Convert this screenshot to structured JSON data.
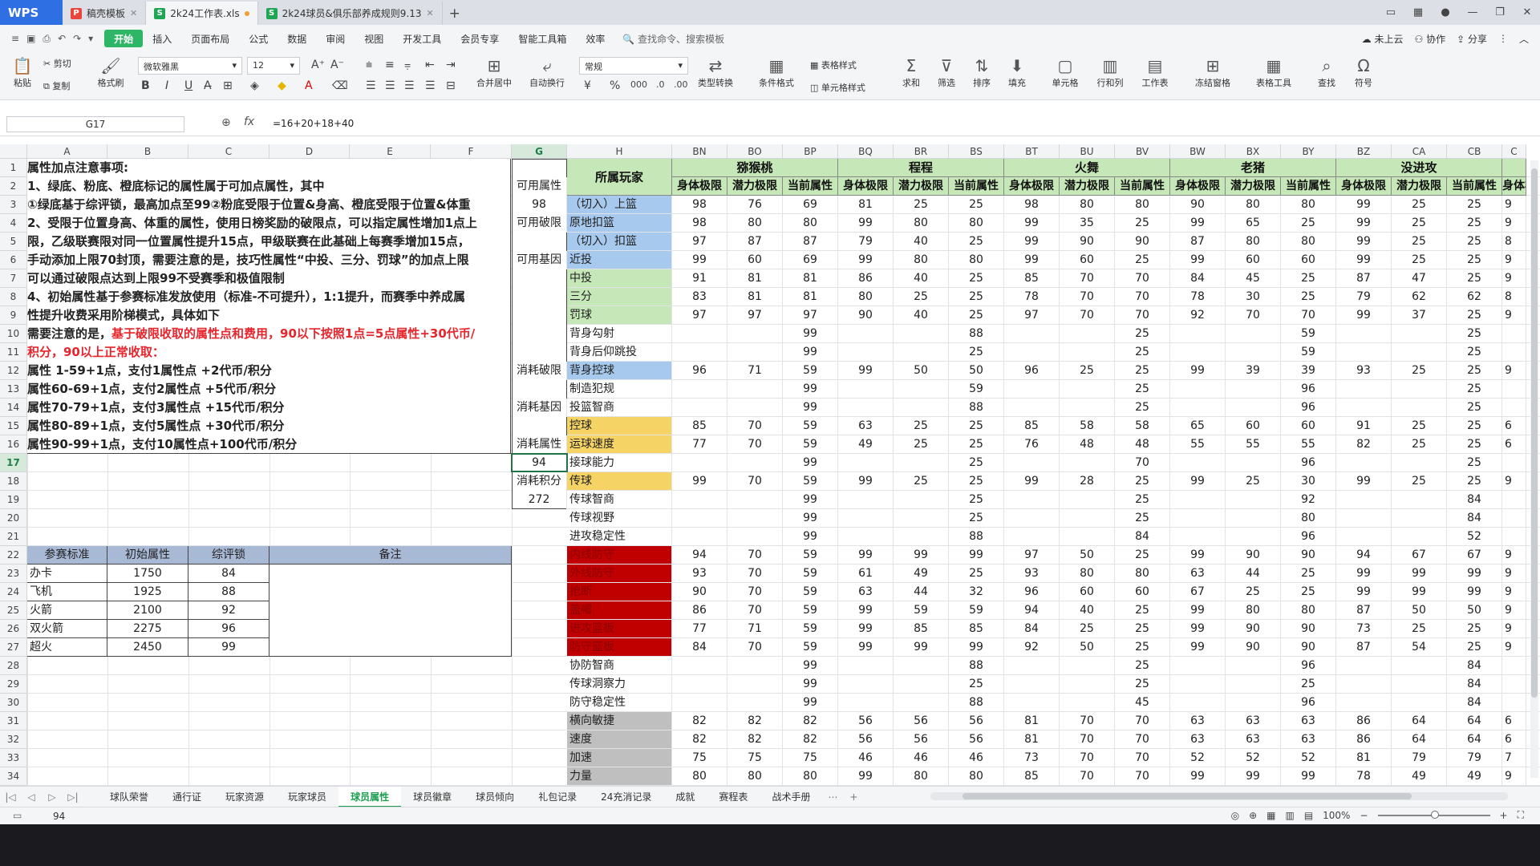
{
  "file_tabs": [
    {
      "label": "稿壳模板",
      "color": "#e8463c",
      "icon": "P",
      "active": false
    },
    {
      "label": "2k24工作表.xls",
      "color": "#1fa654",
      "icon": "S",
      "active": true
    },
    {
      "label": "2k24球员&俱乐部养成规则9.13",
      "color": "#1fa654",
      "icon": "S",
      "active": false
    }
  ],
  "menu": [
    "开始",
    "插入",
    "页面布局",
    "公式",
    "数据",
    "审阅",
    "视图",
    "开发工具",
    "会员专享",
    "智能工具箱",
    "效率"
  ],
  "menu_active": "开始",
  "search_placeholder": "查找命令、搜索模板",
  "menu_right": {
    "cloud": "未上云",
    "collab": "协作",
    "share": "分享"
  },
  "ribbon": {
    "paste": "粘贴",
    "cut": "剪切",
    "copy": "复制",
    "format_painter": "格式刷",
    "font_name": "微软雅黑",
    "font_size": "12",
    "number_format": "常规",
    "merge": "合并居中",
    "wrap": "自动换行",
    "type_convert": "类型转换",
    "cond_format": "条件格式",
    "table_style": "表格样式",
    "cell_style": "单元格样式",
    "sum": "求和",
    "filter": "筛选",
    "sort": "排序",
    "fill": "填充",
    "cell": "单元格",
    "row_col": "行和列",
    "worksheet": "工作表",
    "freeze": "冻结窗格",
    "table_tools": "表格工具",
    "find": "查找",
    "symbol": "符号"
  },
  "formula_bar": {
    "name_box": "G17",
    "formula": "=16+20+18+40"
  },
  "col_headers": [
    {
      "label": "A",
      "w": 100
    },
    {
      "label": "B",
      "w": 101
    },
    {
      "label": "C",
      "w": 101
    },
    {
      "label": "D",
      "w": 100
    },
    {
      "label": "E",
      "w": 101
    },
    {
      "label": "F",
      "w": 101
    },
    {
      "label": "G",
      "w": 69,
      "sel": true
    },
    {
      "label": "H",
      "w": 131
    },
    {
      "label": "BN",
      "w": 69
    },
    {
      "label": "BO",
      "w": 69
    },
    {
      "label": "BP",
      "w": 69
    },
    {
      "label": "BQ",
      "w": 69
    },
    {
      "label": "BR",
      "w": 69
    },
    {
      "label": "BS",
      "w": 69
    },
    {
      "label": "BT",
      "w": 69
    },
    {
      "label": "BU",
      "w": 69
    },
    {
      "label": "BV",
      "w": 69
    },
    {
      "label": "BW",
      "w": 69
    },
    {
      "label": "BX",
      "w": 69
    },
    {
      "label": "BY",
      "w": 69
    },
    {
      "label": "BZ",
      "w": 69
    },
    {
      "label": "CA",
      "w": 69
    },
    {
      "label": "CB",
      "w": 69
    },
    {
      "label": "C",
      "w": 30
    }
  ],
  "rows": [
    "1",
    "2",
    "3",
    "4",
    "5",
    "6",
    "7",
    "8",
    "9",
    "10",
    "11",
    "12",
    "13",
    "14",
    "15",
    "16",
    "17",
    "18",
    "19",
    "20",
    "21",
    "22",
    "23",
    "24",
    "25",
    "26",
    "27",
    "28",
    "29",
    "30",
    "31",
    "32",
    "33",
    "34"
  ],
  "notes": [
    {
      "row": 0,
      "text": "属性加点注意事项:",
      "red": false
    },
    {
      "row": 1,
      "text": "1、绿底、粉底、橙底标记的属性属于可加点属性，其中",
      "red": false
    },
    {
      "row": 2,
      "text": "①绿底基于综评锁，最高加点至99②粉底受限于位置&身高、橙底受限于位置&体重",
      "red": false
    },
    {
      "row": 3,
      "text": "2、受限于位置身高、体重的属性，使用日榜奖励的破限点，可以指定属性增加1点上",
      "red": false
    },
    {
      "row": 4,
      "text": "限，乙级联赛限对同一位置属性提升15点，甲级联赛在此基础上每赛季增加15点，",
      "red": false
    },
    {
      "row": 5,
      "text": "手动添加上限70封顶，需要注意的是，技巧性属性“中投、三分、罚球”的加点上限",
      "red": false
    },
    {
      "row": 6,
      "text": "可以通过破限点达到上限99不受赛季和极值限制",
      "red": false
    },
    {
      "row": 7,
      "text": "4、初始属性基于参赛标准发放使用（标准-不可提升），1:1提升，而赛季中养成属",
      "red": false
    },
    {
      "row": 8,
      "text": "性提升收费采用阶梯模式，具体如下",
      "red": false
    }
  ],
  "note_row9": {
    "prefix": "需要注意的是，",
    "red": "基于破限收取的属性点和费用，90以下按照1点=5点属性+30代币/"
  },
  "note_row10": "积分，90以上正常收取：",
  "price_rows": [
    {
      "row": 11,
      "text": "属性  1-59+1点，支付1属性点      +2代币/积分"
    },
    {
      "row": 12,
      "text": "属性60-69+1点，支付2属性点      +5代币/积分"
    },
    {
      "row": 13,
      "text": "属性70-79+1点，支付3属性点     +15代币/积分"
    },
    {
      "row": 14,
      "text": "属性80-89+1点，支付5属性点     +30代币/积分"
    },
    {
      "row": 15,
      "text": "属性90-99+1点，支付10属性点+100代币/积分"
    }
  ],
  "std_table": {
    "headers": [
      "参赛标准",
      "初始属性",
      "综评锁",
      "备注"
    ],
    "rows": [
      [
        "办卡",
        "1750",
        "84"
      ],
      [
        "飞机",
        "1925",
        "88"
      ],
      [
        "火箭",
        "2100",
        "92"
      ],
      [
        "双火箭",
        "2275",
        "96"
      ],
      [
        "超火",
        "2450",
        "99"
      ]
    ]
  },
  "g_col": {
    "1": "可用属性",
    "2": "98",
    "3": "可用破限",
    "5": "可用基因",
    "11": "消耗破限",
    "13": "消耗基因",
    "15": "消耗属性",
    "16": "94",
    "17": "消耗积分",
    "18": "272"
  },
  "player_header": "所属玩家",
  "players": [
    "猕猴桃",
    "程程",
    "火舞",
    "老猪",
    "没进攻"
  ],
  "sub_headers": [
    "身体极限",
    "潜力极限",
    "当前属性"
  ],
  "attributes": [
    {
      "name": "（切入）上篮",
      "bg": "#a7c9ee"
    },
    {
      "name": "原地扣篮",
      "bg": "#a7c9ee"
    },
    {
      "name": "（切入）扣篮",
      "bg": "#a7c9ee"
    },
    {
      "name": "近投",
      "bg": "#a7c9ee"
    },
    {
      "name": "中投",
      "bg": "#c6e8b8"
    },
    {
      "name": "三分",
      "bg": "#c6e8b8"
    },
    {
      "name": "罚球",
      "bg": "#c6e8b8"
    },
    {
      "name": "背身勾射",
      "bg": ""
    },
    {
      "name": "背身后仰跳投",
      "bg": ""
    },
    {
      "name": "背身控球",
      "bg": "#a7c9ee"
    },
    {
      "name": "制造犯规",
      "bg": ""
    },
    {
      "name": "投篮智商",
      "bg": ""
    },
    {
      "name": "控球",
      "bg": "#f5d465"
    },
    {
      "name": "运球速度",
      "bg": "#f5d465"
    },
    {
      "name": "接球能力",
      "bg": ""
    },
    {
      "name": "传球",
      "bg": "#f5d465"
    },
    {
      "name": "传球智商",
      "bg": ""
    },
    {
      "name": "传球视野",
      "bg": ""
    },
    {
      "name": "进攻稳定性",
      "bg": ""
    },
    {
      "name": "内线防守",
      "bg": "#c00000"
    },
    {
      "name": "外线防守",
      "bg": "#c00000"
    },
    {
      "name": "抢断",
      "bg": "#c00000"
    },
    {
      "name": "盖帽",
      "bg": "#c00000"
    },
    {
      "name": "进攻篮板",
      "bg": "#c00000"
    },
    {
      "name": "防守篮板",
      "bg": "#c00000"
    },
    {
      "name": "协防智商",
      "bg": ""
    },
    {
      "name": "传球洞察力",
      "bg": ""
    },
    {
      "name": "防守稳定性",
      "bg": ""
    },
    {
      "name": "横向敏捷",
      "bg": "#bfbfbf"
    },
    {
      "name": "速度",
      "bg": "#bfbfbf"
    },
    {
      "name": "加速",
      "bg": "#bfbfbf"
    },
    {
      "name": "力量",
      "bg": "#bfbfbf"
    }
  ],
  "values": [
    [
      "98",
      "76",
      "69",
      "81",
      "25",
      "25",
      "98",
      "80",
      "80",
      "90",
      "80",
      "80",
      "99",
      "25",
      "25",
      "9"
    ],
    [
      "98",
      "80",
      "80",
      "99",
      "80",
      "80",
      "99",
      "35",
      "25",
      "99",
      "65",
      "25",
      "99",
      "25",
      "25",
      "9"
    ],
    [
      "97",
      "87",
      "87",
      "79",
      "40",
      "25",
      "99",
      "90",
      "90",
      "87",
      "80",
      "80",
      "99",
      "25",
      "25",
      "8"
    ],
    [
      "99",
      "60",
      "69",
      "99",
      "80",
      "80",
      "99",
      "60",
      "25",
      "99",
      "60",
      "60",
      "99",
      "25",
      "25",
      "9"
    ],
    [
      "91",
      "81",
      "81",
      "86",
      "40",
      "25",
      "85",
      "70",
      "70",
      "84",
      "45",
      "25",
      "87",
      "47",
      "25",
      "9"
    ],
    [
      "83",
      "81",
      "81",
      "80",
      "25",
      "25",
      "78",
      "70",
      "70",
      "78",
      "30",
      "25",
      "79",
      "62",
      "62",
      "8"
    ],
    [
      "97",
      "97",
      "97",
      "90",
      "40",
      "25",
      "97",
      "70",
      "70",
      "92",
      "70",
      "70",
      "99",
      "37",
      "25",
      "9"
    ],
    [
      "",
      "",
      "99",
      "",
      "",
      "88",
      "",
      "",
      "25",
      "",
      "",
      "59",
      "",
      "",
      "25",
      ""
    ],
    [
      "",
      "",
      "99",
      "",
      "",
      "25",
      "",
      "",
      "25",
      "",
      "",
      "59",
      "",
      "",
      "25",
      ""
    ],
    [
      "96",
      "71",
      "59",
      "99",
      "50",
      "50",
      "96",
      "25",
      "25",
      "99",
      "39",
      "39",
      "93",
      "25",
      "25",
      "9"
    ],
    [
      "",
      "",
      "99",
      "",
      "",
      "59",
      "",
      "",
      "25",
      "",
      "",
      "96",
      "",
      "",
      "25",
      ""
    ],
    [
      "",
      "",
      "99",
      "",
      "",
      "88",
      "",
      "",
      "25",
      "",
      "",
      "96",
      "",
      "",
      "25",
      ""
    ],
    [
      "85",
      "70",
      "59",
      "63",
      "25",
      "25",
      "85",
      "58",
      "58",
      "65",
      "60",
      "60",
      "91",
      "25",
      "25",
      "6"
    ],
    [
      "77",
      "70",
      "59",
      "49",
      "25",
      "25",
      "76",
      "48",
      "48",
      "55",
      "55",
      "55",
      "82",
      "25",
      "25",
      "6"
    ],
    [
      "",
      "",
      "99",
      "",
      "",
      "25",
      "",
      "",
      "70",
      "",
      "",
      "96",
      "",
      "",
      "25",
      ""
    ],
    [
      "99",
      "70",
      "59",
      "99",
      "25",
      "25",
      "99",
      "28",
      "25",
      "99",
      "25",
      "30",
      "99",
      "25",
      "25",
      "9"
    ],
    [
      "",
      "",
      "99",
      "",
      "",
      "25",
      "",
      "",
      "25",
      "",
      "",
      "92",
      "",
      "",
      "84",
      ""
    ],
    [
      "",
      "",
      "99",
      "",
      "",
      "25",
      "",
      "",
      "25",
      "",
      "",
      "80",
      "",
      "",
      "84",
      ""
    ],
    [
      "",
      "",
      "99",
      "",
      "",
      "88",
      "",
      "",
      "84",
      "",
      "",
      "96",
      "",
      "",
      "52",
      ""
    ],
    [
      "94",
      "70",
      "59",
      "99",
      "99",
      "99",
      "97",
      "50",
      "25",
      "99",
      "90",
      "90",
      "94",
      "67",
      "67",
      "9"
    ],
    [
      "93",
      "70",
      "59",
      "61",
      "49",
      "25",
      "93",
      "80",
      "80",
      "63",
      "44",
      "25",
      "99",
      "99",
      "99",
      "9"
    ],
    [
      "90",
      "70",
      "59",
      "63",
      "44",
      "32",
      "96",
      "60",
      "60",
      "67",
      "25",
      "25",
      "99",
      "99",
      "99",
      "9"
    ],
    [
      "86",
      "70",
      "59",
      "99",
      "59",
      "59",
      "94",
      "40",
      "25",
      "99",
      "80",
      "80",
      "87",
      "50",
      "50",
      "9"
    ],
    [
      "77",
      "71",
      "59",
      "99",
      "85",
      "85",
      "84",
      "25",
      "25",
      "99",
      "90",
      "90",
      "73",
      "25",
      "25",
      "9"
    ],
    [
      "84",
      "70",
      "59",
      "99",
      "99",
      "99",
      "92",
      "50",
      "25",
      "99",
      "90",
      "90",
      "87",
      "54",
      "25",
      "9"
    ],
    [
      "",
      "",
      "99",
      "",
      "",
      "88",
      "",
      "",
      "25",
      "",
      "",
      "96",
      "",
      "",
      "84",
      ""
    ],
    [
      "",
      "",
      "99",
      "",
      "",
      "25",
      "",
      "",
      "25",
      "",
      "",
      "25",
      "",
      "",
      "84",
      ""
    ],
    [
      "",
      "",
      "99",
      "",
      "",
      "88",
      "",
      "",
      "45",
      "",
      "",
      "96",
      "",
      "",
      "84",
      ""
    ],
    [
      "82",
      "82",
      "82",
      "56",
      "56",
      "56",
      "81",
      "70",
      "70",
      "63",
      "63",
      "63",
      "86",
      "64",
      "64",
      "6"
    ],
    [
      "82",
      "82",
      "82",
      "56",
      "56",
      "56",
      "81",
      "70",
      "70",
      "63",
      "63",
      "63",
      "86",
      "64",
      "64",
      "6"
    ],
    [
      "75",
      "75",
      "75",
      "46",
      "46",
      "46",
      "73",
      "70",
      "70",
      "52",
      "52",
      "52",
      "81",
      "79",
      "79",
      "7"
    ],
    [
      "80",
      "80",
      "80",
      "99",
      "80",
      "80",
      "85",
      "70",
      "70",
      "99",
      "99",
      "99",
      "78",
      "49",
      "49",
      "9"
    ]
  ],
  "sheet_tabs": [
    "球队荣誉",
    "通行证",
    "玩家资源",
    "玩家球员",
    "球员属性",
    "球员徽章",
    "球员倾向",
    "礼包记录",
    "24充消记录",
    "成就",
    "赛程表",
    "战术手册"
  ],
  "sheet_active": "球员属性",
  "status": {
    "value": "94",
    "zoom": "100%"
  }
}
